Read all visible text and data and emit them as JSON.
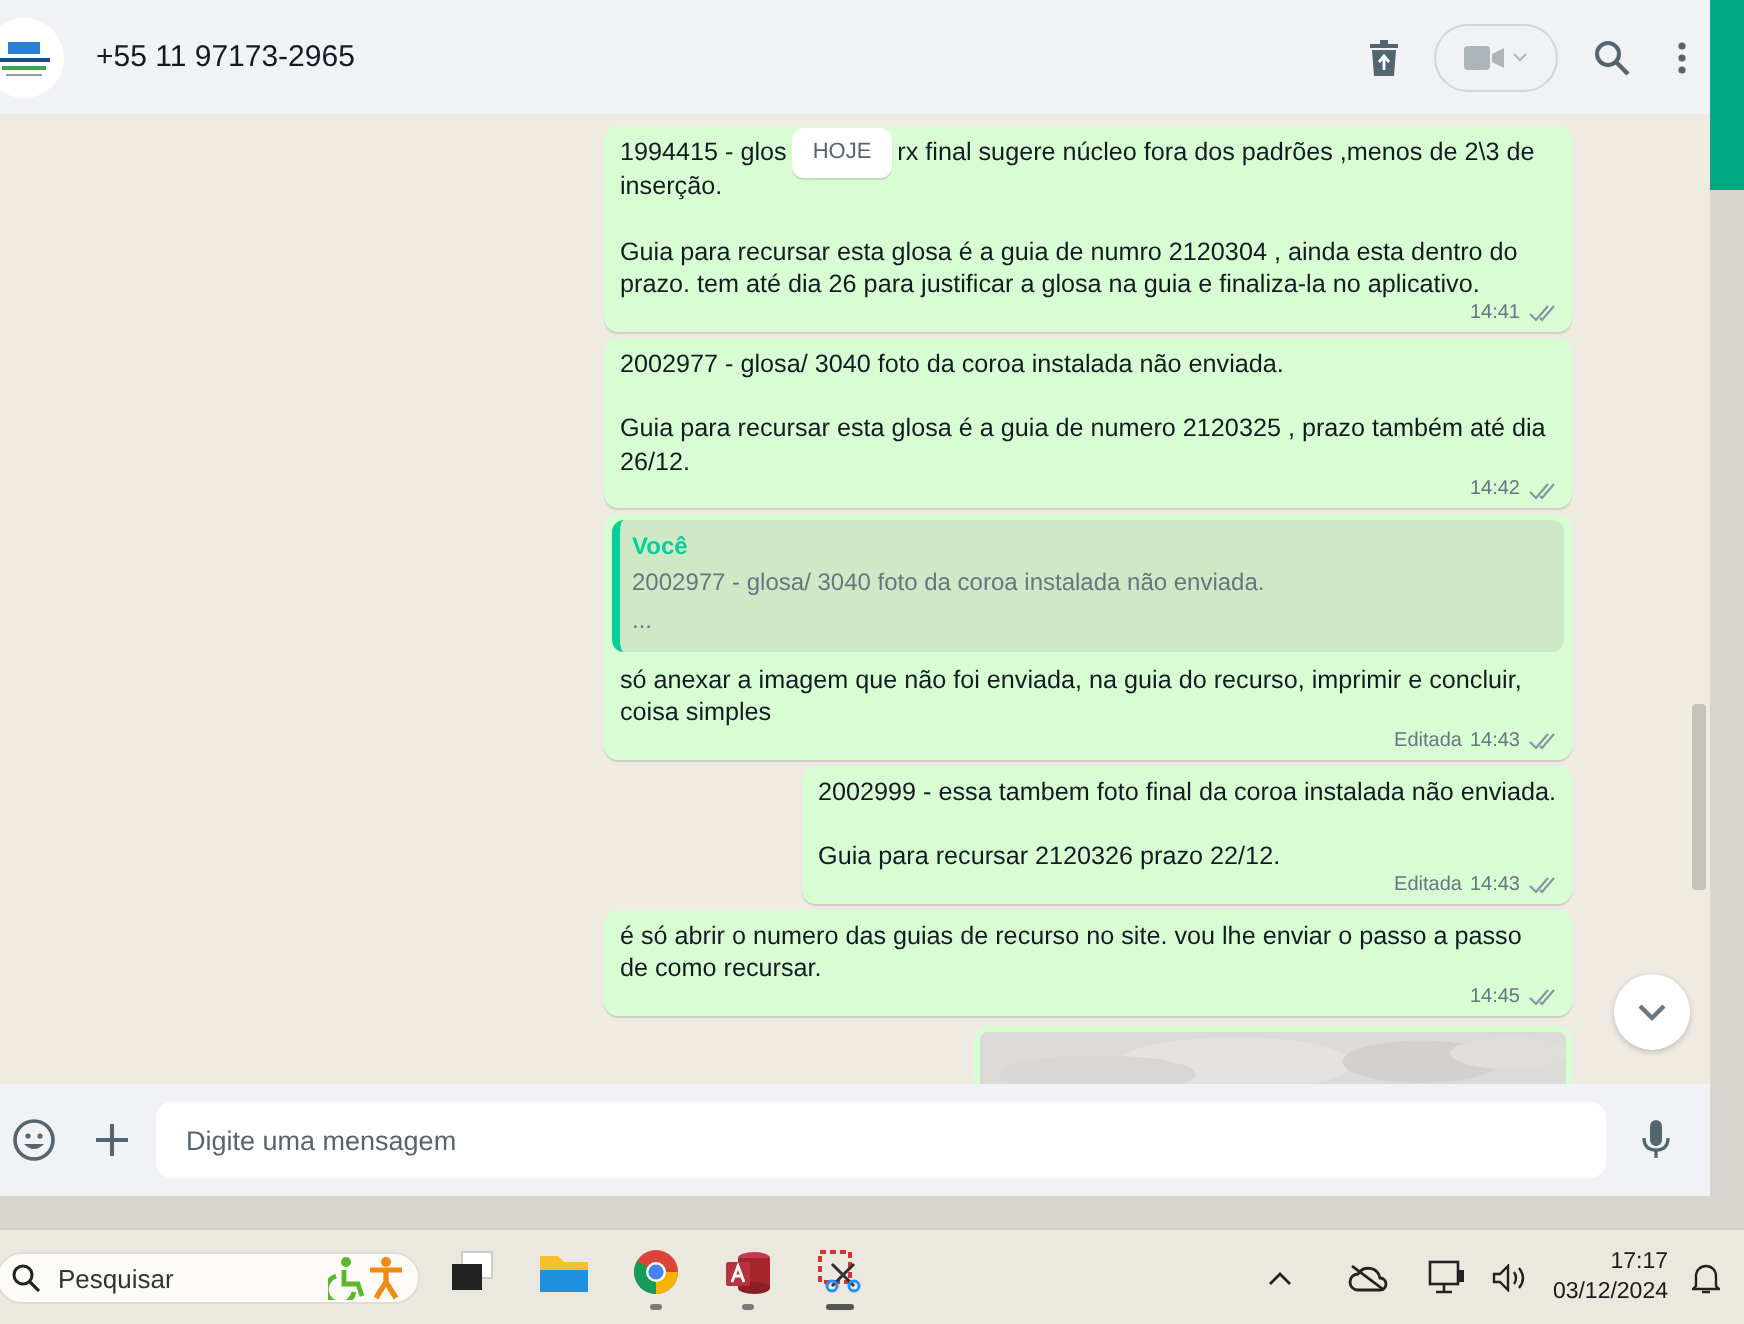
{
  "header": {
    "contact": "+55 11 97173-2965"
  },
  "date_badge": "HOJE",
  "messages": [
    {
      "kind": "text",
      "badge_split": [
        "1994415 - glos",
        "rx final sugere núcleo fora dos padrões ,menos de 2\\3 de",
        "inserção."
      ],
      "paragraphs": [
        "Guia para recursar esta glosa é a guia de numro 2120304 , ainda esta dentro do prazo. tem até dia 26 para justificar a glosa na guia e finaliza-la no aplicativo."
      ],
      "time": "14:41"
    },
    {
      "kind": "text",
      "paragraphs": [
        "2002977 - glosa/ 3040 foto da coroa instalada não enviada.",
        "Guia para recursar esta glosa é a guia de numero 2120325  , prazo também até dia 26/12."
      ],
      "time": "14:42"
    },
    {
      "kind": "reply",
      "quote": {
        "author": "Você",
        "text": "2002977 - glosa/ 3040 foto da coroa instalada não enviada.",
        "more": "..."
      },
      "paragraphs": [
        "só anexar a imagem que não foi enviada, na guia do recurso, imprimir e concluir, coisa simples"
      ],
      "edited": "Editada",
      "time": "14:43"
    },
    {
      "kind": "text",
      "paragraphs": [
        "2002999 - essa tambem foto final da coroa instalada não enviada.",
        "Guia para recursar   2120326 prazo 22/12."
      ],
      "edited": "Editada",
      "time": "14:43"
    },
    {
      "kind": "text",
      "paragraphs": [
        "é só abrir o numero das guias de recurso no site. vou lhe enviar o passo a passo de como recursar."
      ],
      "time": "14:45"
    },
    {
      "kind": "picture"
    }
  ],
  "composer": {
    "placeholder": "Digite uma mensagem"
  },
  "taskbar": {
    "search": {
      "placeholder": "Pesquisar"
    },
    "apps": [
      {
        "kind": "taskview",
        "running": false,
        "active": false
      },
      {
        "kind": "explorer",
        "running": false,
        "active": false
      },
      {
        "kind": "chrome",
        "running": true,
        "active": false
      },
      {
        "kind": "access",
        "running": true,
        "active": false
      },
      {
        "kind": "snip",
        "running": true,
        "active": true
      }
    ],
    "time": "17:17",
    "date": "03/12/2024"
  }
}
